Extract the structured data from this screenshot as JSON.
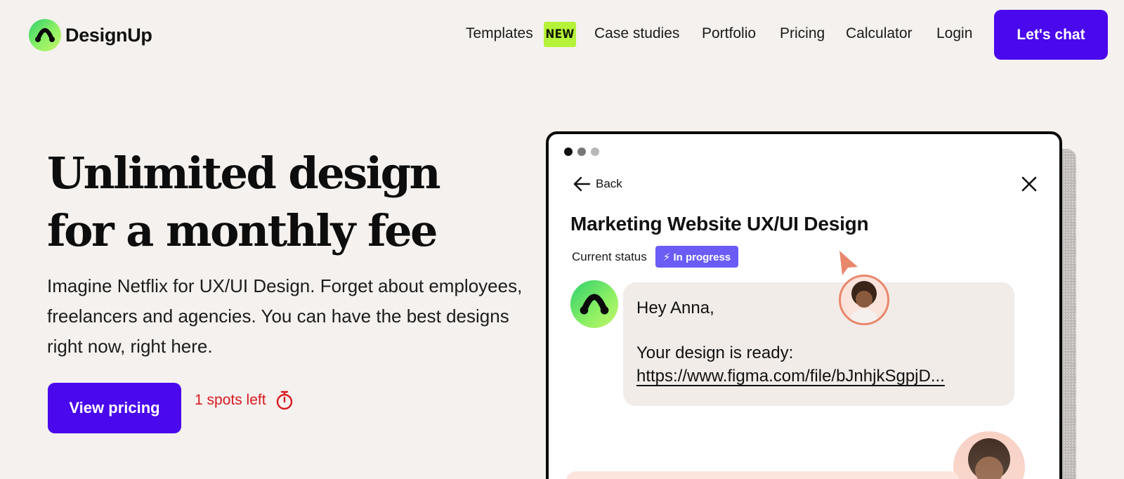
{
  "brand": {
    "name": "DesignUp",
    "gradient": [
      "#2fd06e",
      "#c6f46a"
    ]
  },
  "nav": {
    "items": [
      {
        "label": "Templates",
        "badge": "NEW"
      },
      {
        "label": "Case studies"
      },
      {
        "label": "Portfolio"
      },
      {
        "label": "Pricing"
      },
      {
        "label": "Calculator"
      },
      {
        "label": "Login"
      }
    ],
    "cta": "Let's chat"
  },
  "hero": {
    "title_line1": "Unlimited design",
    "title_line2": "for a monthly fee",
    "subtitle": "Imagine Netflix for UX/UI Design. Forget about employees, freelancers and agencies. You can have the best designs right now, right here.",
    "cta": "View pricing",
    "spots": "1 spots left"
  },
  "mock": {
    "back": "Back",
    "title": "Marketing Website UX/UI Design",
    "status_label": "Current status",
    "status_value": "⚡ In progress",
    "message": {
      "greeting": "Hey Anna,",
      "line2": "Your design is ready:",
      "link": "https://www.figma.com/file/bJnhjkSgpjD..."
    }
  },
  "colors": {
    "accent": "#4a08ec",
    "background": "#f4f1ee",
    "badge_new": "#b5f23a",
    "status": "#6a5cf5",
    "spots": "#d71920"
  }
}
